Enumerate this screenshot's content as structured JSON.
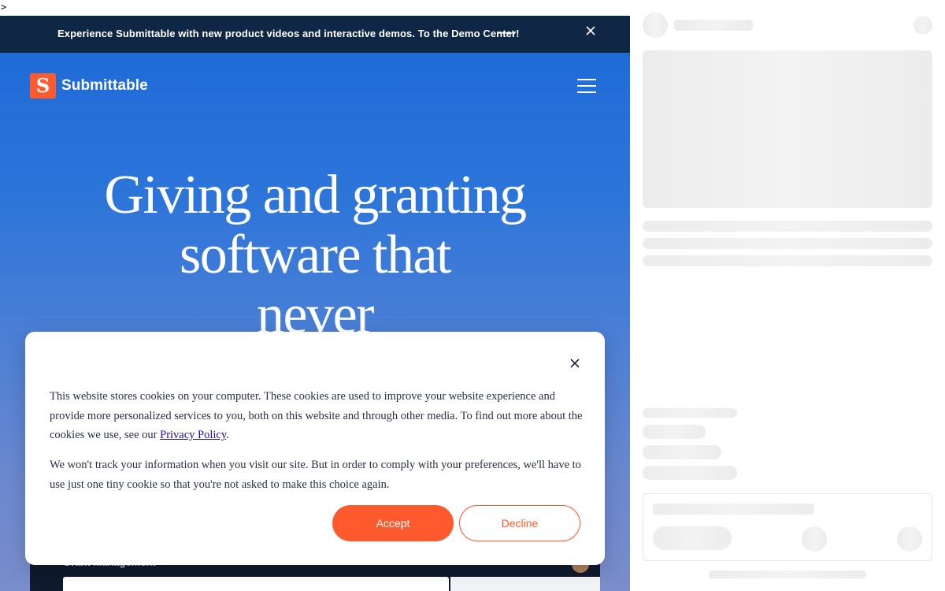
{
  "stray_char": ">",
  "promo": {
    "text": "Experience Submittable with new product videos and interactive demos. To the Demo Center!",
    "arrow": "⟶",
    "close_icon": "close-icon"
  },
  "header": {
    "logo_text": "Submittable",
    "logo_glyph": "S",
    "menu_icon": "hamburger-menu-icon"
  },
  "hero": {
    "title_line1": "Giving and granting",
    "title_line2": "software that",
    "title_line3": "never"
  },
  "frame": {
    "title": "Grant Management"
  },
  "cookie": {
    "p1_text": "This website stores cookies on your computer. These cookies are used to improve your website experience and provide more personalized services to you, both on this website and through other media. To find out more about the cookies we use, see our ",
    "privacy_link": "Privacy Policy",
    "p1_end": ".",
    "p2_text": "We won't track your information when you visit our site. But in order to comply with your preferences, we'll have to use just one tiny cookie so that you're not asked to make this choice again.",
    "accept_label": "Accept",
    "decline_label": "Decline"
  },
  "colors": {
    "brand_orange": "#ff5a2e",
    "promo_bg": "#0f2645",
    "hero_blue": "#1c69d6"
  }
}
